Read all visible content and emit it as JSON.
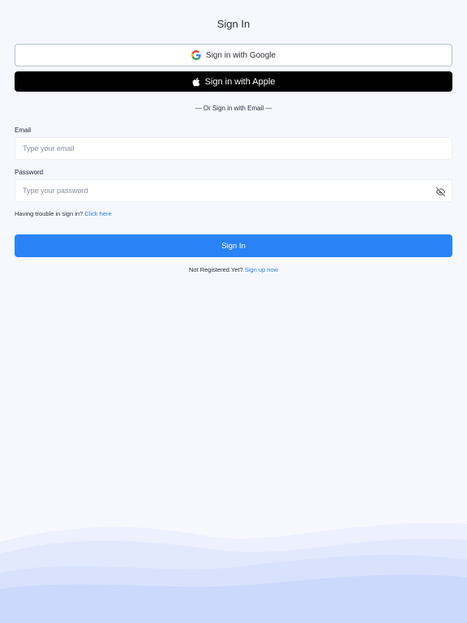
{
  "header": {
    "title": "Sign In"
  },
  "social": {
    "google_label": "Sign in with Google",
    "apple_label": "Sign in with Apple"
  },
  "divider": {
    "text": "— Or Sign in with Email —"
  },
  "form": {
    "email_label": "Email",
    "email_placeholder": "Type your email",
    "email_value": "",
    "password_label": "Password",
    "password_placeholder": "Type your password",
    "password_value": ""
  },
  "help": {
    "text": "Having trouble in sign in?",
    "link": "Click here"
  },
  "submit": {
    "label": "Sign In"
  },
  "register": {
    "text": "Not Registered Yet?",
    "link": "Sign up now"
  },
  "icons": {
    "google": "google-icon",
    "apple": "apple-icon",
    "password_toggle": "eye-off-icon"
  },
  "colors": {
    "background": "#f6f8fd",
    "primary": "#2a82f7",
    "link": "#2a7ef5",
    "apple_button": "#000000",
    "wave_light": "#e4eaff",
    "wave_dark": "#c9d6fc"
  }
}
